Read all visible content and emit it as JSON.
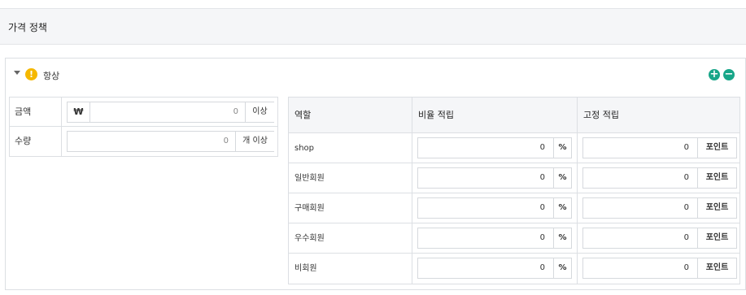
{
  "header": {
    "title": "가격 정책"
  },
  "panel": {
    "title": "항상",
    "add_symbol": "+",
    "remove_symbol": "−",
    "conditions": {
      "amount": {
        "label": "금액",
        "currency": "₩",
        "value": "0",
        "suffix": "이상"
      },
      "quantity": {
        "label": "수량",
        "value": "0",
        "suffix": "개 이상"
      }
    },
    "reward_table": {
      "headers": {
        "role": "역할",
        "ratio": "비율 적립",
        "fixed": "고정 적립"
      },
      "rows": [
        {
          "role": "shop",
          "ratio": "0",
          "ratio_unit": "%",
          "fixed": "0",
          "fixed_unit": "포인트"
        },
        {
          "role": "일반회원",
          "ratio": "0",
          "ratio_unit": "%",
          "fixed": "0",
          "fixed_unit": "포인트"
        },
        {
          "role": "구매회원",
          "ratio": "0",
          "ratio_unit": "%",
          "fixed": "0",
          "fixed_unit": "포인트"
        },
        {
          "role": "우수회원",
          "ratio": "0",
          "ratio_unit": "%",
          "fixed": "0",
          "fixed_unit": "포인트"
        },
        {
          "role": "비회원",
          "ratio": "0",
          "ratio_unit": "%",
          "fixed": "0",
          "fixed_unit": "포인트"
        }
      ]
    }
  },
  "icons": {
    "warning": "!",
    "toggle": "caret-down-icon"
  },
  "colors": {
    "accent": "#18a689",
    "warning": "#f5b800"
  }
}
